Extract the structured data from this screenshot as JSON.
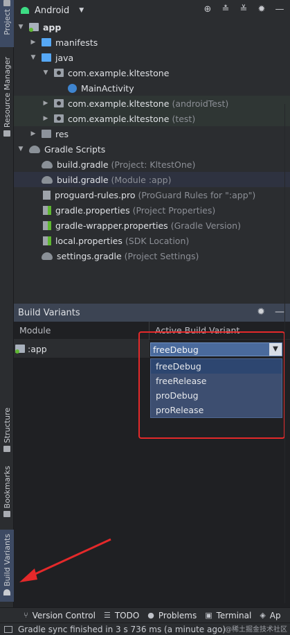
{
  "left_stripe": {
    "tabs": [
      {
        "label": "Project",
        "icon": "folder-icon",
        "active": true
      },
      {
        "label": "Resource Manager",
        "icon": "resource-icon",
        "active": false
      },
      {
        "label": "Structure",
        "icon": "structure-icon",
        "active": false
      },
      {
        "label": "Bookmarks",
        "icon": "bookmark-icon",
        "active": false
      },
      {
        "label": "Build Variants",
        "icon": "android-icon",
        "active": true
      }
    ]
  },
  "project": {
    "view_selector": "Android",
    "header_icons": [
      "target-icon",
      "expand-all-icon",
      "collapse-all-icon",
      "settings-icon",
      "minimize-icon"
    ],
    "tree": [
      {
        "name": "app",
        "hint": "",
        "icon": "module-icon",
        "expanded": true
      },
      {
        "name": "manifests",
        "hint": "",
        "icon": "folder-icon",
        "expanded": false
      },
      {
        "name": "java",
        "hint": "",
        "icon": "folder-icon",
        "expanded": true
      },
      {
        "name": "com.example.kltestone",
        "hint": "",
        "icon": "package-icon",
        "expanded": true
      },
      {
        "name": "MainActivity",
        "hint": "",
        "icon": "kotlin-class-icon",
        "expanded": null
      },
      {
        "name": "com.example.kltestone",
        "hint": "(androidTest)",
        "icon": "package-icon",
        "expanded": false
      },
      {
        "name": "com.example.kltestone",
        "hint": "(test)",
        "icon": "package-icon",
        "expanded": false
      },
      {
        "name": "res",
        "hint": "",
        "icon": "res-folder-icon",
        "expanded": false
      },
      {
        "name": "Gradle Scripts",
        "hint": "",
        "icon": "gradle-icon",
        "expanded": true
      },
      {
        "name": "build.gradle",
        "hint": "(Project: KltestOne)",
        "icon": "gradle-icon",
        "expanded": null
      },
      {
        "name": "build.gradle",
        "hint": "(Module :app)",
        "icon": "gradle-icon",
        "expanded": null
      },
      {
        "name": "proguard-rules.pro",
        "hint": "(ProGuard Rules for \":app\")",
        "icon": "file-icon",
        "expanded": null
      },
      {
        "name": "gradle.properties",
        "hint": "(Project Properties)",
        "icon": "properties-icon",
        "expanded": null
      },
      {
        "name": "gradle-wrapper.properties",
        "hint": "(Gradle Version)",
        "icon": "properties-icon",
        "expanded": null
      },
      {
        "name": "local.properties",
        "hint": "(SDK Location)",
        "icon": "properties-icon",
        "expanded": null
      },
      {
        "name": "settings.gradle",
        "hint": "(Project Settings)",
        "icon": "gradle-icon",
        "expanded": null
      }
    ]
  },
  "build_variants": {
    "title": "Build Variants",
    "col_module": "Module",
    "col_variant": "Active Build Variant",
    "module": ":app",
    "selected": "freeDebug",
    "options": [
      "freeDebug",
      "freeRelease",
      "proDebug",
      "proRelease"
    ]
  },
  "bottom_bar": {
    "items": [
      {
        "label": "Version Control",
        "icon": "branch-icon"
      },
      {
        "label": "TODO",
        "icon": "list-icon"
      },
      {
        "label": "Problems",
        "icon": "problems-icon"
      },
      {
        "label": "Terminal",
        "icon": "terminal-icon"
      },
      {
        "label": "Ap",
        "icon": "app-inspection-icon"
      }
    ]
  },
  "status": {
    "message": "Gradle sync finished in 3 s 736 ms (a minute ago)",
    "watermark": "@稀土掘金技术社区"
  },
  "colors": {
    "highlight_red": "#e4292a",
    "selection_blue": "#4a6a9c",
    "panel_bg": "#2b2d30"
  }
}
